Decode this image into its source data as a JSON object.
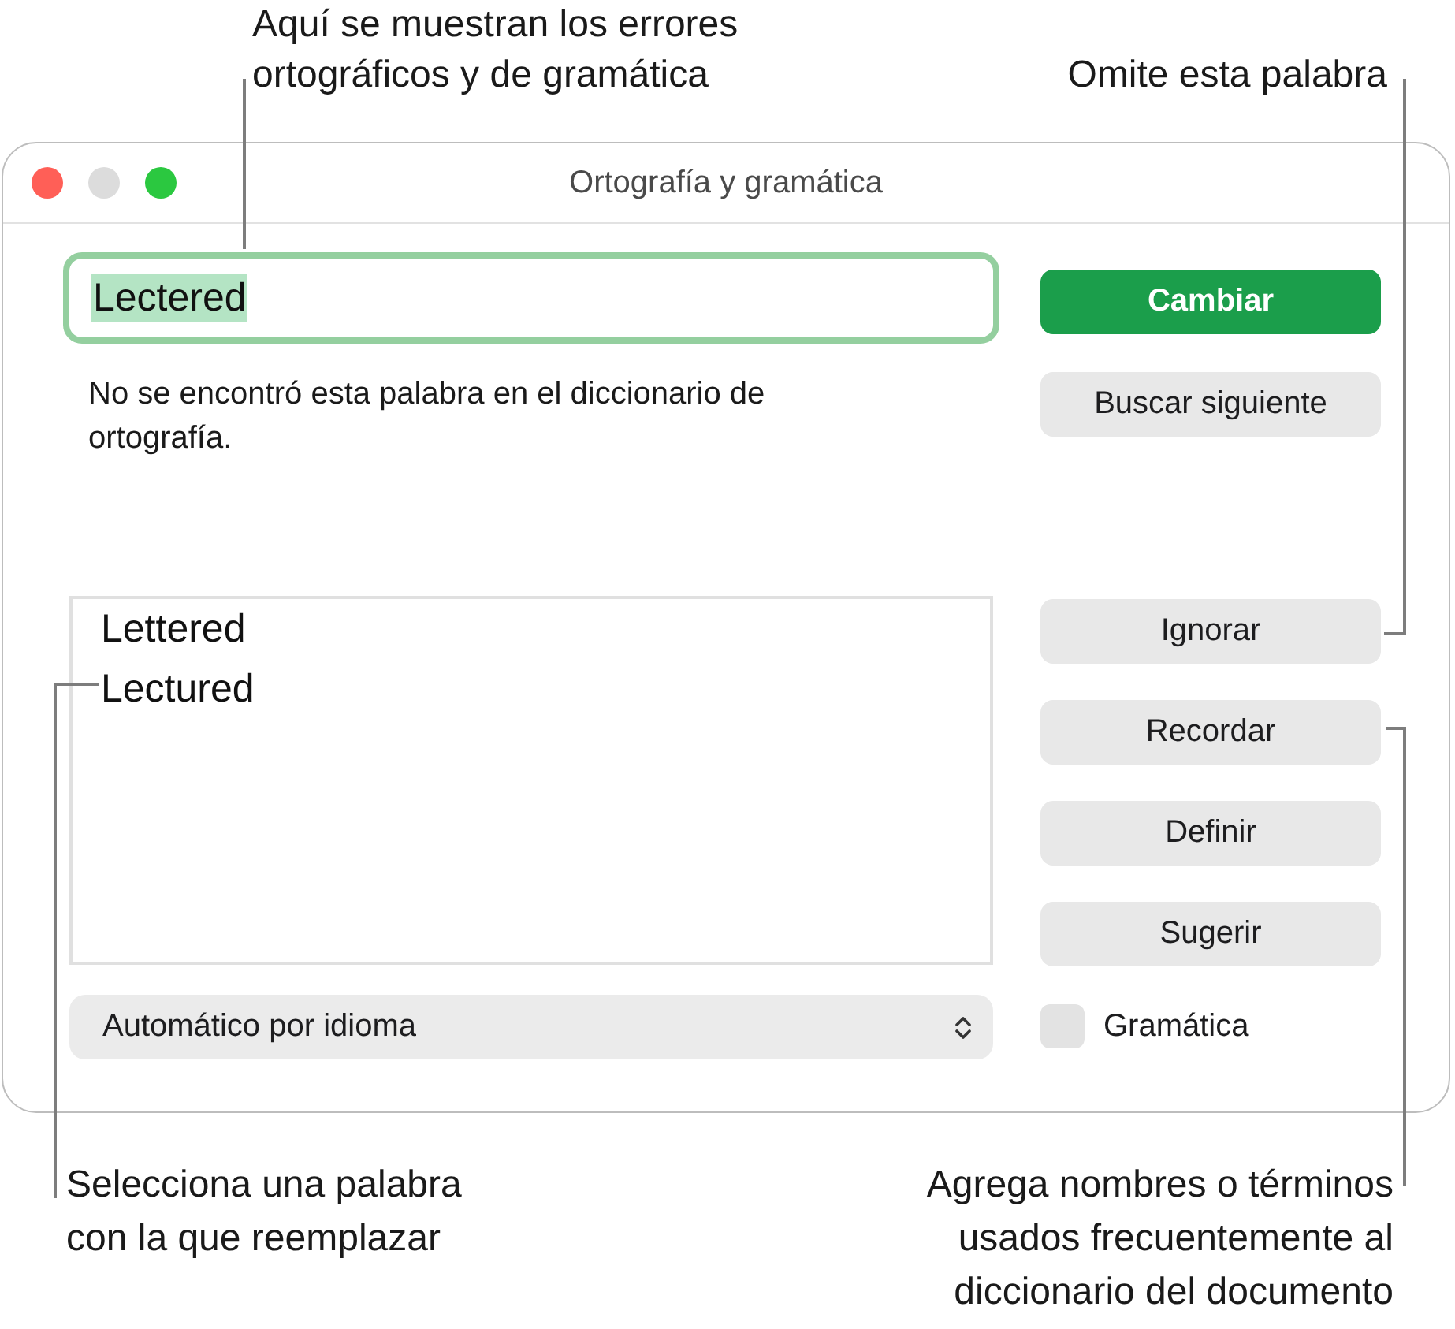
{
  "callouts": [
    {
      "text": "Aquí se muestran los errores ortográficos y de gramática"
    },
    {
      "text": "Omite esta palabra"
    },
    {
      "text": "Selecciona una palabra con la que reemplazar"
    },
    {
      "text": "Agrega nombres o términos usados frecuentemente al diccionario del documento"
    }
  ],
  "window": {
    "title": "Ortografía y gramática",
    "controls": [
      {
        "kind": "close",
        "disabled": false
      },
      {
        "kind": "minimize",
        "disabled": true
      },
      {
        "kind": "zoom",
        "disabled": false
      }
    ]
  },
  "word_field": {
    "value": "Lectered",
    "focused": true,
    "highlighted": true
  },
  "message": "No se encontró esta palabra en el diccionario de ortografía.",
  "buttons": [
    {
      "label": "Cambiar",
      "kind": "primary"
    },
    {
      "label": "Buscar siguiente",
      "kind": "default"
    },
    {
      "label": "Ignorar",
      "kind": "default"
    },
    {
      "label": "Recordar",
      "kind": "default"
    },
    {
      "label": "Definir",
      "kind": "default"
    },
    {
      "label": "Sugerir",
      "kind": "default"
    }
  ],
  "suggestions": [
    {
      "text": "Lettered",
      "selected": false
    },
    {
      "text": "Lectured",
      "selected": false
    }
  ],
  "language_menu": {
    "value": "Automático por idioma"
  },
  "grammar_checkbox": {
    "label": "Gramática",
    "checked": false
  }
}
